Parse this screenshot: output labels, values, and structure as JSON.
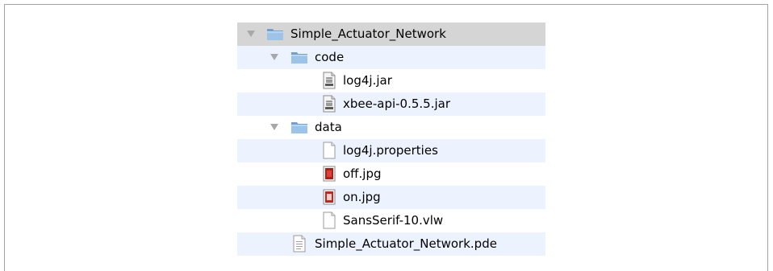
{
  "tree": {
    "rows": [
      {
        "label": "Simple_Actuator_Network",
        "icon": "folder-icon",
        "level": 0,
        "expanded": true,
        "selected": true
      },
      {
        "label": "code",
        "icon": "folder-icon",
        "level": 1,
        "expanded": true
      },
      {
        "label": "log4j.jar",
        "icon": "jar-file-icon",
        "level": 2
      },
      {
        "label": "xbee-api-0.5.5.jar",
        "icon": "jar-file-icon",
        "level": 2
      },
      {
        "label": "data",
        "icon": "folder-icon",
        "level": 1,
        "expanded": true
      },
      {
        "label": "log4j.properties",
        "icon": "blank-file-icon",
        "level": 2
      },
      {
        "label": "off.jpg",
        "icon": "image-file-icon",
        "level": 2
      },
      {
        "label": "on.jpg",
        "icon": "image-file-icon",
        "level": 2
      },
      {
        "label": "SansSerif-10.vlw",
        "icon": "blank-file-icon",
        "level": 2
      },
      {
        "label": "Simple_Actuator_Network.pde",
        "icon": "text-file-icon",
        "level": 1
      }
    ]
  },
  "colors": {
    "selected_row": "#d5d5d5",
    "alternate_row": "#edf3fe",
    "folder": "#8fb8de",
    "image_icon_red": "#c8231f"
  }
}
